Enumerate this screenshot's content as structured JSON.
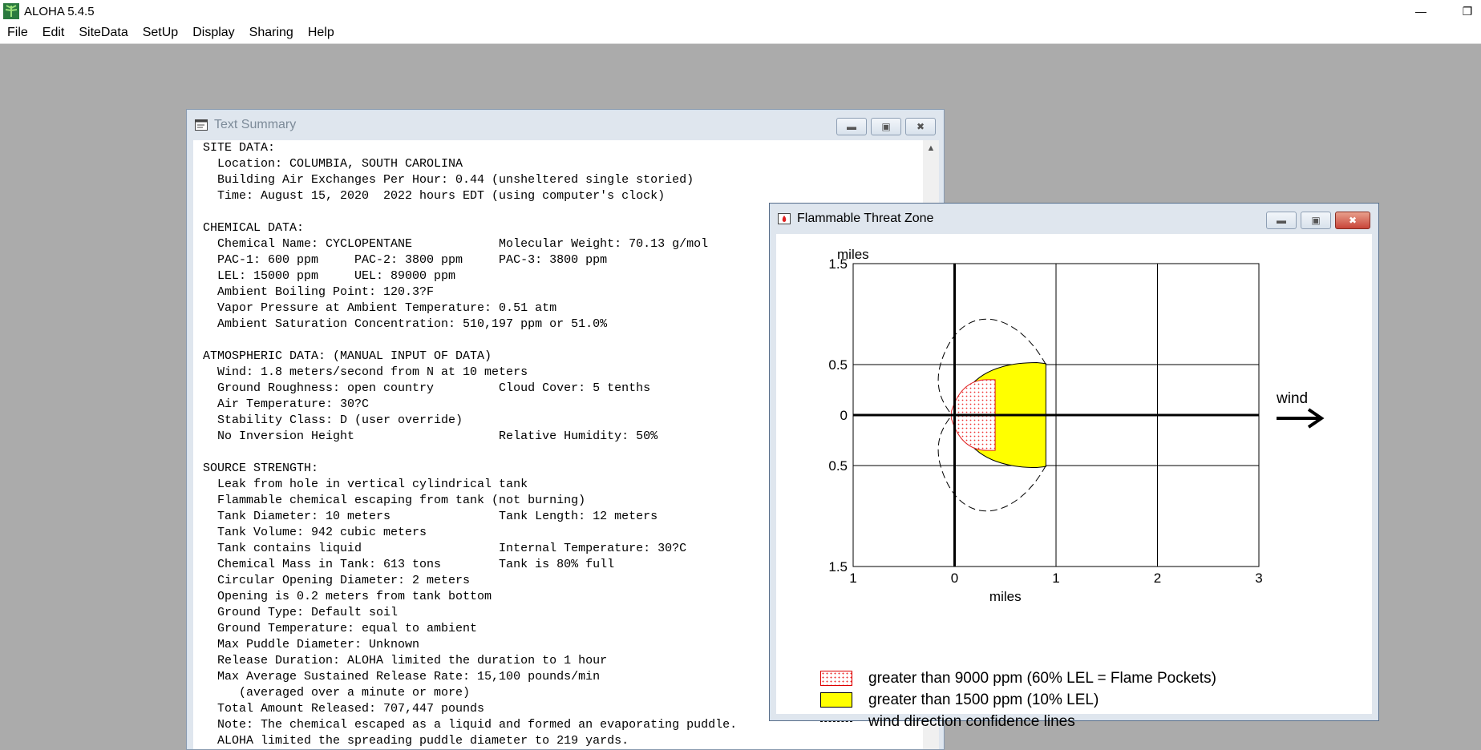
{
  "app": {
    "title": "ALOHA 5.4.5",
    "minimize": "—",
    "restore": "❐"
  },
  "menu": [
    "File",
    "Edit",
    "SiteData",
    "SetUp",
    "Display",
    "Sharing",
    "Help"
  ],
  "summary_window": {
    "title": "Text Summary",
    "lines": [
      "SITE DATA:",
      "  Location: COLUMBIA, SOUTH CAROLINA",
      "  Building Air Exchanges Per Hour: 0.44 (unsheltered single storied)",
      "  Time: August 15, 2020  2022 hours EDT (using computer's clock)",
      "",
      "CHEMICAL DATA:",
      "  Chemical Name: CYCLOPENTANE            Molecular Weight: 70.13 g/mol",
      "  PAC-1: 600 ppm     PAC-2: 3800 ppm     PAC-3: 3800 ppm",
      "  LEL: 15000 ppm     UEL: 89000 ppm",
      "  Ambient Boiling Point: 120.3?F",
      "  Vapor Pressure at Ambient Temperature: 0.51 atm",
      "  Ambient Saturation Concentration: 510,197 ppm or 51.0%",
      "",
      "ATMOSPHERIC DATA: (MANUAL INPUT OF DATA)",
      "  Wind: 1.8 meters/second from N at 10 meters",
      "  Ground Roughness: open country         Cloud Cover: 5 tenths",
      "  Air Temperature: 30?C",
      "  Stability Class: D (user override)",
      "  No Inversion Height                    Relative Humidity: 50%",
      "",
      "SOURCE STRENGTH:",
      "  Leak from hole in vertical cylindrical tank",
      "  Flammable chemical escaping from tank (not burning)",
      "  Tank Diameter: 10 meters               Tank Length: 12 meters",
      "  Tank Volume: 942 cubic meters",
      "  Tank contains liquid                   Internal Temperature: 30?C",
      "  Chemical Mass in Tank: 613 tons        Tank is 80% full",
      "  Circular Opening Diameter: 2 meters",
      "  Opening is 0.2 meters from tank bottom",
      "  Ground Type: Default soil",
      "  Ground Temperature: equal to ambient",
      "  Max Puddle Diameter: Unknown",
      "  Release Duration: ALOHA limited the duration to 1 hour",
      "  Max Average Sustained Release Rate: 15,100 pounds/min",
      "     (averaged over a minute or more)",
      "  Total Amount Released: 707,447 pounds",
      "  Note: The chemical escaped as a liquid and formed an evaporating puddle.",
      "  ALOHA limited the spreading puddle diameter to 219 yards."
    ]
  },
  "threat_window": {
    "title": "Flammable Threat Zone",
    "wind_label": "wind",
    "legend": [
      {
        "label": "greater than 9000 ppm (60% LEL = Flame Pockets)",
        "swatch": "pocket"
      },
      {
        "label": "greater than 1500 ppm (10% LEL)",
        "swatch": "lel"
      },
      {
        "label": "wind direction confidence lines",
        "swatch": "dash"
      }
    ]
  },
  "chart_data": {
    "type": "area",
    "xlabel": "miles",
    "ylabel": "miles",
    "x_ticks": [
      "1",
      "0",
      "1",
      "2",
      "3"
    ],
    "y_ticks": [
      "1.5",
      "0.5",
      "0",
      "0.5",
      "1.5"
    ],
    "xlim": [
      -1,
      3
    ],
    "ylim": [
      -1.5,
      1.5
    ],
    "grid": true,
    "zones": [
      {
        "name": "greater than 9000 ppm (60% LEL = Flame Pockets)",
        "color": "#ff0000",
        "downwind_extent": 0.4,
        "max_half_width": 0.35
      },
      {
        "name": "greater than 1500 ppm (10% LEL)",
        "color": "#ffff00",
        "downwind_extent": 0.9,
        "max_half_width": 0.52
      }
    ],
    "confidence_lines": {
      "half_width": 1.0,
      "downwind_extent": 0.9
    }
  }
}
